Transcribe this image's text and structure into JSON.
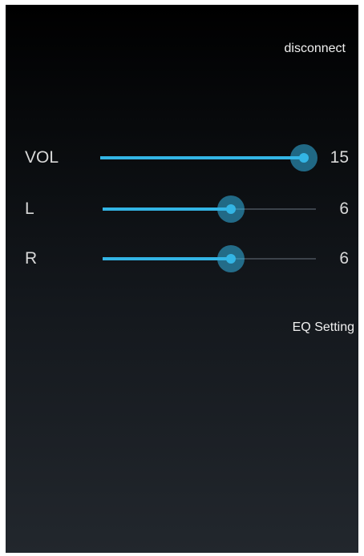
{
  "header": {
    "disconnect_label": "disconnect"
  },
  "sliders": [
    {
      "id": "vol",
      "label": "VOL",
      "value": "15",
      "fraction": 1.0
    },
    {
      "id": "l",
      "label": "L",
      "value": "6",
      "fraction": 0.6
    },
    {
      "id": "r",
      "label": "R",
      "value": "6",
      "fraction": 0.6
    }
  ],
  "eq": {
    "label": "EQ Setting"
  },
  "colors": {
    "accent": "#33b5e5",
    "track": "#3c434b",
    "background_top": "#000000",
    "background_bottom": "#22272d",
    "text": "#d8d8d8"
  }
}
